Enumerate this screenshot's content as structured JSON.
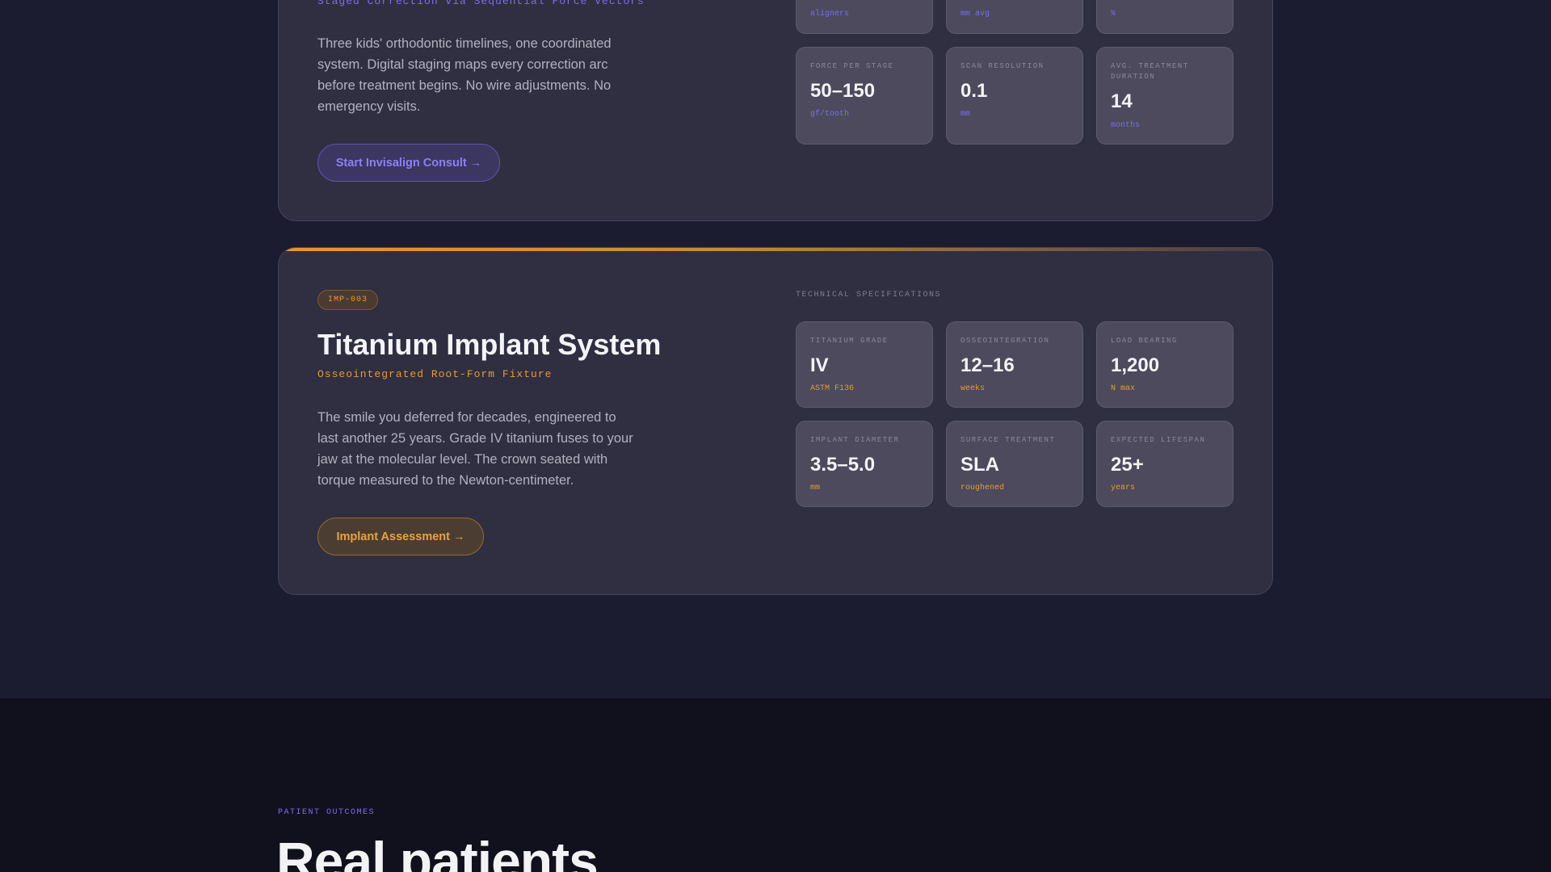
{
  "invisalign": {
    "subtitle": "Staged Correction via Sequential Force Vectors",
    "description": "Three kids' orthodontic timelines, one coordinated system. Digital staging maps every correction arc before treatment begins. No wire adjustments. No emergency visits.",
    "cta": "Start Invisalign Consult →",
    "top_units": [
      "aligners",
      "mm avg",
      "%"
    ],
    "stats": [
      {
        "label": "Force per stage",
        "value": "50–150",
        "unit": "gf/tooth"
      },
      {
        "label": "Scan resolution",
        "value": "0.1",
        "unit": "mm"
      },
      {
        "label": "Avg. treatment duration",
        "value": "14",
        "unit": "months"
      }
    ]
  },
  "implant": {
    "badge": "IMP-003",
    "title": "Titanium Implant System",
    "subtitle": "Osseointegrated Root-Form Fixture",
    "description": "The smile you deferred for decades, engineered to last another 25 years. Grade IV titanium fuses to your jaw at the molecular level. The crown seated with torque measured to the Newton-centimeter.",
    "cta": "Implant Assessment →",
    "spec_heading": "TECHNICAL SPECIFICATIONS",
    "stats": [
      {
        "label": "Titanium grade",
        "value": "IV",
        "unit": "ASTM F136"
      },
      {
        "label": "Osseointegration",
        "value": "12–16",
        "unit": "weeks"
      },
      {
        "label": "Load bearing",
        "value": "1,200",
        "unit": "N max"
      },
      {
        "label": "Implant diameter",
        "value": "3.5–5.0",
        "unit": "mm"
      },
      {
        "label": "Surface treatment",
        "value": "SLA",
        "unit": "roughened"
      },
      {
        "label": "Expected lifespan",
        "value": "25+",
        "unit": "years"
      }
    ]
  },
  "outcomes": {
    "eyebrow": "PATIENT OUTCOMES",
    "heading": "Real patients"
  },
  "colors": {
    "accent_purple": "#7a6ef0",
    "accent_orange": "#e69a35",
    "card_bg": "#302e41",
    "page_bg": "#1c1c30"
  }
}
